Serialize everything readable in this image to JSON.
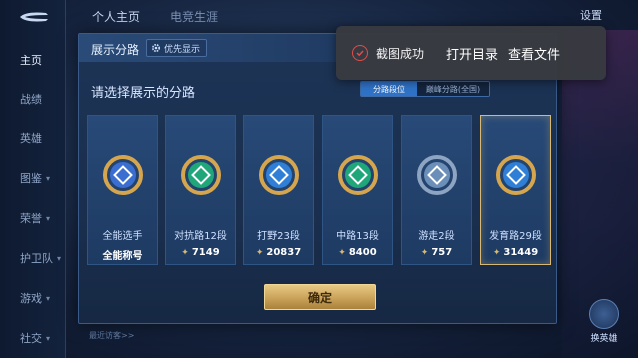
{
  "top_tabs": [
    "个人主页",
    "电竞生涯"
  ],
  "settings_label": "设置",
  "sidebar": {
    "items": [
      {
        "label": "主页",
        "active": true,
        "chevron": false
      },
      {
        "label": "战绩",
        "active": false,
        "chevron": false
      },
      {
        "label": "英雄",
        "active": false,
        "chevron": false
      },
      {
        "label": "图鉴",
        "active": false,
        "chevron": true
      },
      {
        "label": "荣誉",
        "active": false,
        "chevron": true
      },
      {
        "label": "护卫队",
        "active": false,
        "chevron": true
      },
      {
        "label": "游戏",
        "active": false,
        "chevron": true
      },
      {
        "label": "社交",
        "active": false,
        "chevron": true
      }
    ]
  },
  "modal": {
    "title": "展示分路",
    "priority_label": "优先显示",
    "prompt": "请选择展示的分路",
    "toggle": {
      "options": [
        "分路段位",
        "巅峰分路(全国)"
      ],
      "selected": 0
    },
    "cards": [
      {
        "label": "全能选手",
        "value": "全能称号",
        "has_points": false,
        "selected": false,
        "icon": "all-round-badge-icon",
        "ring": "#d5a64e",
        "core": "#3a6fd1"
      },
      {
        "label": "对抗路12段",
        "value": "7149",
        "has_points": true,
        "selected": false,
        "icon": "clash-lane-badge-icon",
        "ring": "#d5a64e",
        "core": "#1fa77a"
      },
      {
        "label": "打野23段",
        "value": "20837",
        "has_points": true,
        "selected": false,
        "icon": "jungle-badge-icon",
        "ring": "#d5a64e",
        "core": "#2f7fd6"
      },
      {
        "label": "中路13段",
        "value": "8400",
        "has_points": true,
        "selected": false,
        "icon": "mid-lane-badge-icon",
        "ring": "#d5a64e",
        "core": "#1fa77a"
      },
      {
        "label": "游走2段",
        "value": "757",
        "has_points": true,
        "selected": false,
        "icon": "roam-badge-icon",
        "ring": "#8da4c2",
        "core": "#6b8fb8"
      },
      {
        "label": "发育路29段",
        "value": "31449",
        "has_points": true,
        "selected": true,
        "icon": "farm-lane-badge-icon",
        "ring": "#d5a64e",
        "core": "#2f7fd6"
      }
    ],
    "confirm_label": "确定",
    "footnote": "最近访客>>"
  },
  "toast": {
    "message": "截图成功",
    "open_folder": "打开目录",
    "view_file": "查看文件"
  },
  "right_button_label": "换英雄",
  "colors": {
    "accent_gold": "#d9b870",
    "toggle_active": "#2f73c9",
    "panel_bg": "#1d3456"
  }
}
